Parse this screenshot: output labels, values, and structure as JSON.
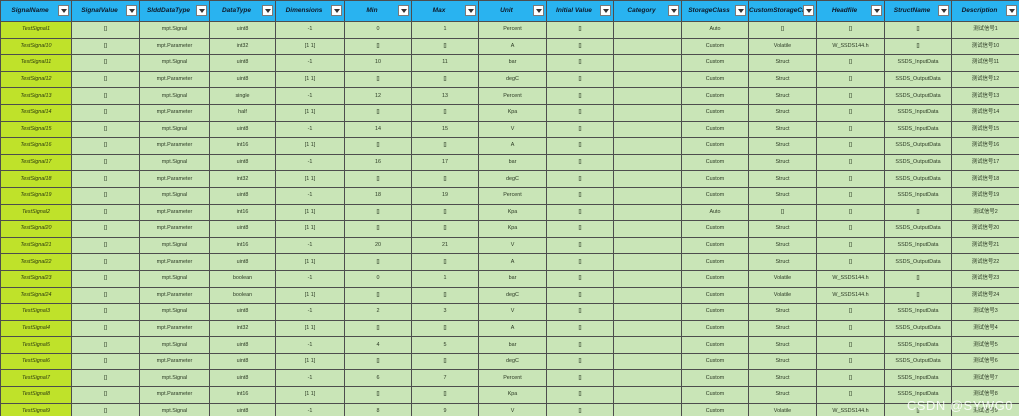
{
  "columns": [
    "SignalName",
    "SignalValue",
    "SlddDataType",
    "DataType",
    "Dimensions",
    "Min",
    "Max",
    "Unit",
    "Initial Value",
    "Category",
    "StorageClass",
    "CustomStorageCla",
    "Headfile",
    "StructName",
    "Description"
  ],
  "rows": [
    [
      "TestSignal1",
      "[]",
      "mpt.Signal",
      "uint8",
      "-1",
      "0",
      "1",
      "Percent",
      "[]",
      "",
      "Auto",
      "[]",
      "[]",
      "[]",
      "测试信号1"
    ],
    [
      "TestSignal10",
      "[]",
      "mpt.Parameter",
      "int32",
      "[1 1]",
      "[]",
      "[]",
      "A",
      "[]",
      "",
      "Custom",
      "Volatile",
      "W_SSDS144.h",
      "[]",
      "测试信号10"
    ],
    [
      "TestSignal11",
      "[]",
      "mpt.Signal",
      "uint8",
      "-1",
      "10",
      "11",
      "bar",
      "[]",
      "",
      "Custom",
      "Struct",
      "[]",
      "SSDS_InputData",
      "测试信号11"
    ],
    [
      "TestSignal12",
      "[]",
      "mpt.Parameter",
      "uint8",
      "[1 1]",
      "[]",
      "[]",
      "degC",
      "[]",
      "",
      "Custom",
      "Struct",
      "[]",
      "SSDS_OutputData",
      "测试信号12"
    ],
    [
      "TestSignal13",
      "[]",
      "mpt.Signal",
      "single",
      "-1",
      "12",
      "13",
      "Percent",
      "[]",
      "",
      "Custom",
      "Struct",
      "[]",
      "SSDS_OutputData",
      "测试信号13"
    ],
    [
      "TestSignal14",
      "[]",
      "mpt.Parameter",
      "half",
      "[1 1]",
      "[]",
      "[]",
      "Kpa",
      "[]",
      "",
      "Custom",
      "Struct",
      "[]",
      "SSDS_InputData",
      "测试信号14"
    ],
    [
      "TestSignal15",
      "[]",
      "mpt.Signal",
      "uint8",
      "-1",
      "14",
      "15",
      "V",
      "[]",
      "",
      "Custom",
      "Struct",
      "[]",
      "SSDS_InputData",
      "测试信号15"
    ],
    [
      "TestSignal16",
      "[]",
      "mpt.Parameter",
      "int16",
      "[1 1]",
      "[]",
      "[]",
      "A",
      "[]",
      "",
      "Custom",
      "Struct",
      "[]",
      "SSDS_OutputData",
      "测试信号16"
    ],
    [
      "TestSignal17",
      "[]",
      "mpt.Signal",
      "uint8",
      "-1",
      "16",
      "17",
      "bar",
      "[]",
      "",
      "Custom",
      "Struct",
      "[]",
      "SSDS_OutputData",
      "测试信号17"
    ],
    [
      "TestSignal18",
      "[]",
      "mpt.Parameter",
      "int32",
      "[1 1]",
      "[]",
      "[]",
      "degC",
      "[]",
      "",
      "Custom",
      "Struct",
      "[]",
      "SSDS_OutputData",
      "测试信号18"
    ],
    [
      "TestSignal19",
      "[]",
      "mpt.Signal",
      "uint8",
      "-1",
      "18",
      "19",
      "Percent",
      "[]",
      "",
      "Custom",
      "Struct",
      "[]",
      "SSDS_InputData",
      "测试信号19"
    ],
    [
      "TestSignal2",
      "[]",
      "mpt.Parameter",
      "int16",
      "[1 1]",
      "[]",
      "[]",
      "Kpa",
      "[]",
      "",
      "Auto",
      "[]",
      "[]",
      "[]",
      "测试信号2"
    ],
    [
      "TestSignal20",
      "[]",
      "mpt.Parameter",
      "uint8",
      "[1 1]",
      "[]",
      "[]",
      "Kpa",
      "[]",
      "",
      "Custom",
      "Struct",
      "[]",
      "SSDS_OutputData",
      "测试信号20"
    ],
    [
      "TestSignal21",
      "[]",
      "mpt.Signal",
      "int16",
      "-1",
      "20",
      "21",
      "V",
      "[]",
      "",
      "Custom",
      "Struct",
      "[]",
      "SSDS_InputData",
      "测试信号21"
    ],
    [
      "TestSignal22",
      "[]",
      "mpt.Parameter",
      "uint8",
      "[1 1]",
      "[]",
      "[]",
      "A",
      "[]",
      "",
      "Custom",
      "Struct",
      "[]",
      "SSDS_OutputData",
      "测试信号22"
    ],
    [
      "TestSignal23",
      "[]",
      "mpt.Signal",
      "boolean",
      "-1",
      "0",
      "1",
      "bar",
      "[]",
      "",
      "Custom",
      "Volatile",
      "W_SSDS144.h",
      "[]",
      "测试信号23"
    ],
    [
      "TestSignal24",
      "[]",
      "mpt.Parameter",
      "boolean",
      "[1 1]",
      "[]",
      "[]",
      "degC",
      "[]",
      "",
      "Custom",
      "Volatile",
      "W_SSDS144.h",
      "[]",
      "测试信号24"
    ],
    [
      "TestSignal3",
      "[]",
      "mpt.Signal",
      "uint8",
      "-1",
      "2",
      "3",
      "V",
      "[]",
      "",
      "Custom",
      "Struct",
      "[]",
      "SSDS_InputData",
      "测试信号3"
    ],
    [
      "TestSignal4",
      "[]",
      "mpt.Parameter",
      "int32",
      "[1 1]",
      "[]",
      "[]",
      "A",
      "[]",
      "",
      "Custom",
      "Struct",
      "[]",
      "SSDS_OutputData",
      "测试信号4"
    ],
    [
      "TestSignal5",
      "[]",
      "mpt.Signal",
      "uint8",
      "-1",
      "4",
      "5",
      "bar",
      "[]",
      "",
      "Custom",
      "Struct",
      "[]",
      "SSDS_InputData",
      "测试信号5"
    ],
    [
      "TestSignal6",
      "[]",
      "mpt.Parameter",
      "uint8",
      "[1 1]",
      "[]",
      "[]",
      "degC",
      "[]",
      "",
      "Custom",
      "Struct",
      "[]",
      "SSDS_OutputData",
      "测试信号6"
    ],
    [
      "TestSignal7",
      "[]",
      "mpt.Signal",
      "uint8",
      "-1",
      "6",
      "7",
      "Percent",
      "[]",
      "",
      "Custom",
      "Struct",
      "[]",
      "SSDS_InputData",
      "测试信号7"
    ],
    [
      "TestSignal8",
      "[]",
      "mpt.Parameter",
      "int16",
      "[1 1]",
      "[]",
      "[]",
      "Kpa",
      "[]",
      "",
      "Custom",
      "Struct",
      "[]",
      "SSDS_InputData",
      "测试信号8"
    ],
    [
      "TestSignal9",
      "[]",
      "mpt.Signal",
      "uint8",
      "-1",
      "8",
      "9",
      "V",
      "[]",
      "",
      "Custom",
      "Volatile",
      "W_SSDS144.h",
      "[]",
      "测试信号9"
    ]
  ],
  "watermark": "CSDN @SYWG0"
}
